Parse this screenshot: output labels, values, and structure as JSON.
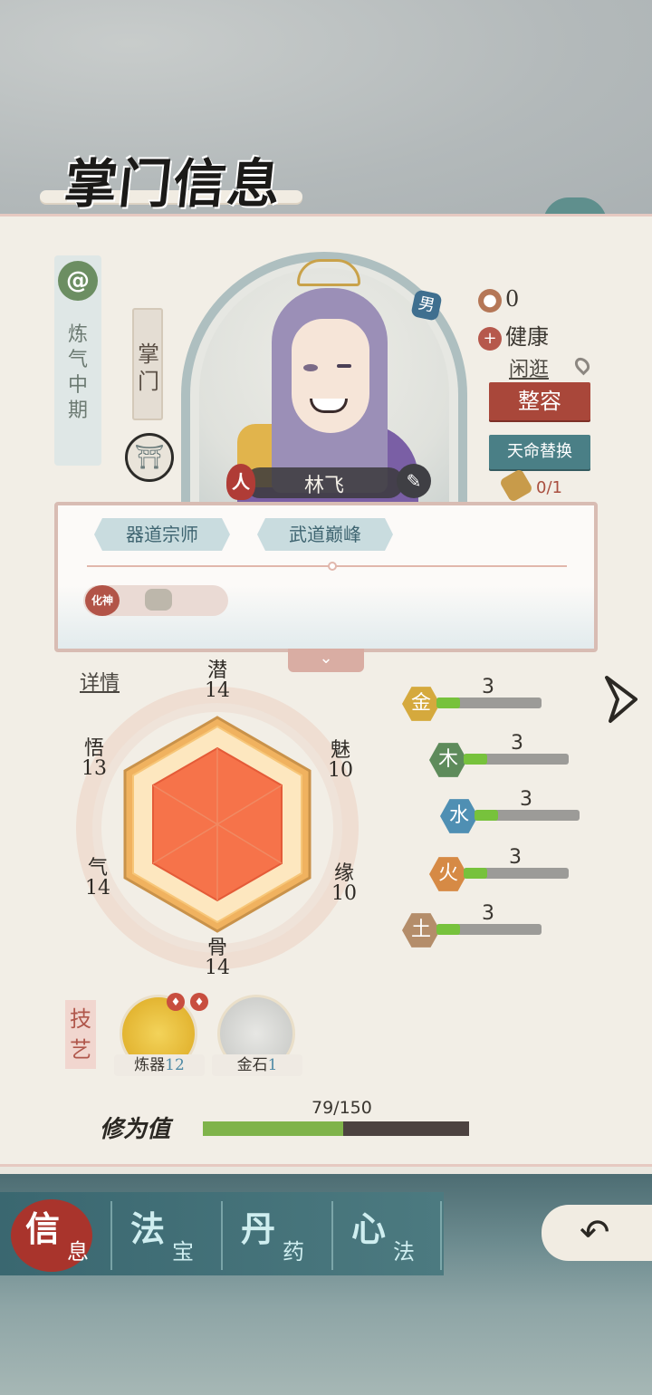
{
  "header": {
    "title": "掌门信息"
  },
  "character": {
    "realm": "炼气中期",
    "role": "掌门",
    "gender": "男",
    "name": "林飞",
    "race_icon": "人",
    "resource_count": "0",
    "health": "健康",
    "activity": "闲逛",
    "makeover_button": "整容",
    "replace_button": "天命替换",
    "scroll_count": "0/1"
  },
  "titles": {
    "tags": [
      "器道宗师",
      "武道巅峰"
    ],
    "rank_badge": "化神"
  },
  "detail_link": "详情",
  "attributes": [
    {
      "name": "潜",
      "value": "14"
    },
    {
      "name": "魅",
      "value": "10"
    },
    {
      "name": "缘",
      "value": "10"
    },
    {
      "name": "骨",
      "value": "14"
    },
    {
      "name": "气",
      "value": "14"
    },
    {
      "name": "悟",
      "value": "13"
    }
  ],
  "elements": [
    {
      "icon": "金",
      "value": "3",
      "color": "#d5a93d",
      "fill": 0.22
    },
    {
      "icon": "木",
      "value": "3",
      "color": "#5e8b5b",
      "fill": 0.22
    },
    {
      "icon": "水",
      "value": "3",
      "color": "#4f8fb3",
      "fill": 0.22
    },
    {
      "icon": "火",
      "value": "3",
      "color": "#d68a45",
      "fill": 0.22
    },
    {
      "icon": "土",
      "value": "3",
      "color": "#b48d6a",
      "fill": 0.22
    }
  ],
  "skills": {
    "label": "技艺",
    "items": [
      {
        "name": "炼器",
        "level": "12"
      },
      {
        "name": "金石",
        "level": "1"
      }
    ]
  },
  "cultivation": {
    "label": "修为值",
    "value": "79/150",
    "fill": 0.527
  },
  "nav": [
    {
      "main": "信",
      "sub": "息"
    },
    {
      "main": "法",
      "sub": "宝"
    },
    {
      "main": "丹",
      "sub": "药"
    },
    {
      "main": "心",
      "sub": "法"
    }
  ]
}
